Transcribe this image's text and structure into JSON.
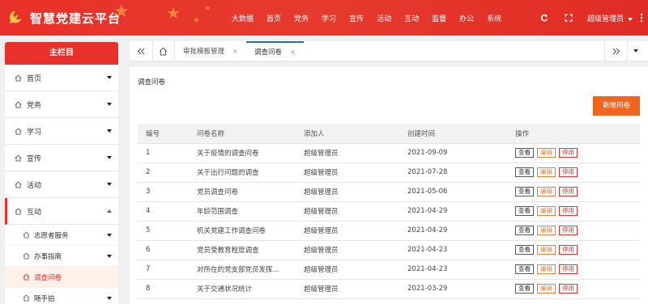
{
  "app": {
    "title": "智慧党建云平台"
  },
  "nav": {
    "items": [
      "大数据",
      "首页",
      "党务",
      "学习",
      "宣传",
      "活动",
      "互动",
      "监督",
      "办公",
      "系统"
    ]
  },
  "user": {
    "name": "超级管理员"
  },
  "icons": {
    "logo": "party-emblem-icon",
    "refresh": "refresh-icon",
    "fullscreen": "fullscreen-icon",
    "more": "more-vertical-icon",
    "caret": "chevron-down-icon"
  },
  "sidebar": {
    "title": "主栏目",
    "items": [
      {
        "label": "首页"
      },
      {
        "label": "党务"
      },
      {
        "label": "学习"
      },
      {
        "label": "宣传"
      },
      {
        "label": "活动"
      },
      {
        "label": "互动"
      }
    ],
    "sub_items": [
      {
        "label": "志愿者服务"
      },
      {
        "label": "办事指南"
      },
      {
        "label": "调查问卷"
      },
      {
        "label": "随手拍"
      }
    ]
  },
  "tabs": [
    {
      "label": "审批模板管理"
    },
    {
      "label": "调查问卷"
    }
  ],
  "content": {
    "breadcrumb": "调查问卷",
    "add_button": "新增问卷",
    "columns": [
      "编号",
      "问卷名称",
      "添加人",
      "创建时间",
      "操作"
    ],
    "actions": {
      "view": "查看",
      "edit": "编辑",
      "stop": "停用"
    },
    "rows": [
      {
        "id": "1",
        "name": "关于疫情的调查问卷",
        "creator": "超级管理员",
        "date": "2021-09-09"
      },
      {
        "id": "2",
        "name": "关于出行问题的调查",
        "creator": "超级管理员",
        "date": "2021-07-28"
      },
      {
        "id": "3",
        "name": "党员调查问卷",
        "creator": "超级管理员",
        "date": "2021-05-06"
      },
      {
        "id": "4",
        "name": "年龄范围调查",
        "creator": "超级管理员",
        "date": "2021-04-29"
      },
      {
        "id": "5",
        "name": "机关党建工作调查问卷",
        "creator": "超级管理员",
        "date": "2021-04-29"
      },
      {
        "id": "6",
        "name": "党员受教育程度调查",
        "creator": "超级管理员",
        "date": "2021-04-23"
      },
      {
        "id": "7",
        "name": "对所在的党支部党员发挥...",
        "creator": "超级管理员",
        "date": "2021-04-23"
      },
      {
        "id": "8",
        "name": "关于交通状况统计",
        "creator": "超级管理员",
        "date": "2021-03-29"
      }
    ]
  },
  "colors": {
    "brand": "#e8312a",
    "accent": "#f0641e",
    "tab_active": "#2a65d6"
  }
}
